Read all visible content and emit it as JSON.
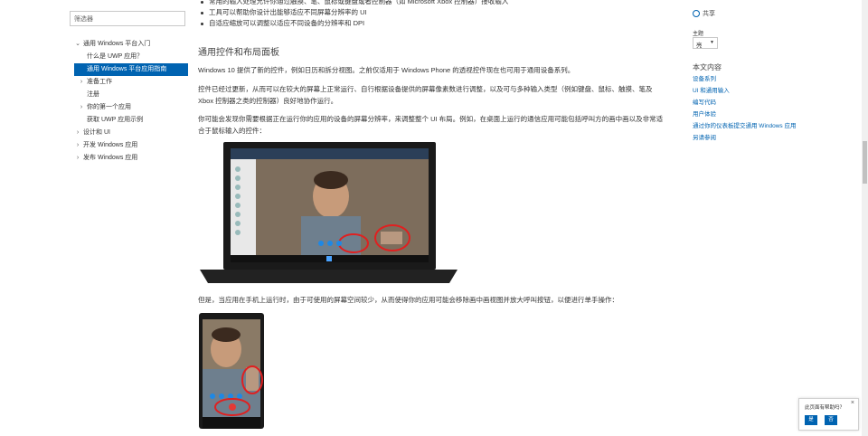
{
  "left_nav": {
    "filter_placeholder": "筛选器",
    "items": [
      {
        "label": "通用 Windows 平台入门",
        "level": 1,
        "chevron": "down"
      },
      {
        "label": "什么是 UWP 应用？",
        "level": 2
      },
      {
        "label": "通用 Windows 平台应用指南",
        "level": 2,
        "active": true
      },
      {
        "label": "准备工作",
        "level": 2,
        "chevron": "right"
      },
      {
        "label": "注册",
        "level": 2
      },
      {
        "label": "你的第一个应用",
        "level": 2,
        "chevron": "right"
      },
      {
        "label": "获取 UWP 应用示例",
        "level": 2
      },
      {
        "label": "设计和 UI",
        "level": 1,
        "chevron": "right"
      },
      {
        "label": "开发 Windows 应用",
        "level": 1,
        "chevron": "right"
      },
      {
        "label": "发布 Windows 应用",
        "level": 1,
        "chevron": "right"
      }
    ]
  },
  "main": {
    "bullets": [
      "常用的输入处理允许你通过触摸、笔、鼠标或键盘或者控制器（如 Microsoft Xbox 控制器）接收输入",
      "工具可以帮助你设计出能够适应不同屏幕分辨率的 UI",
      "自适应缩放可以调整以适应不同设备的分辨率和 DPI"
    ],
    "heading": "通用控件和布局面板",
    "para1": "Windows 10 提供了新的控件，例如日历和拆分视图。之前仅适用于 Windows Phone 的透视控件现在也可用于通用设备系列。",
    "para2": "控件已经过更新，从而可以在较大的屏幕上正常运行、自行根据设备提供的屏幕像素数进行调整，以及可与多种输入类型（例如键盘、鼠标、触摸、笔及 Xbox 控制器之类的控制器）良好地协作运行。",
    "para3": "你可能会发现你需要根据正在运行你的应用的设备的屏幕分辨率，来调整整个 UI 布局。例如，在桌面上运行的通信应用可能包括呼叫方的画中画以及非常适合于鼠标输入的控件：",
    "para4": "但是，当应用在手机上运行时，由于可使用的屏幕空间较少，从而使得你的应用可能会移除画中画视图并放大呼叫按钮，以便进行单手操作："
  },
  "right_rail": {
    "share_label": "共享",
    "theme_label": "主题",
    "theme_value": "亮",
    "toc_title": "本文内容",
    "links": [
      "设备系列",
      "UI 和通用输入",
      "编写代码",
      "用户体验",
      "通过你的仪表板提交通用 Windows 应用",
      "另请参阅"
    ]
  },
  "feedback": {
    "question": "此页面有帮助吗？",
    "yes": "是",
    "no": "否",
    "close": "×"
  },
  "colors": {
    "accent": "#0063b1",
    "text": "#333333"
  }
}
